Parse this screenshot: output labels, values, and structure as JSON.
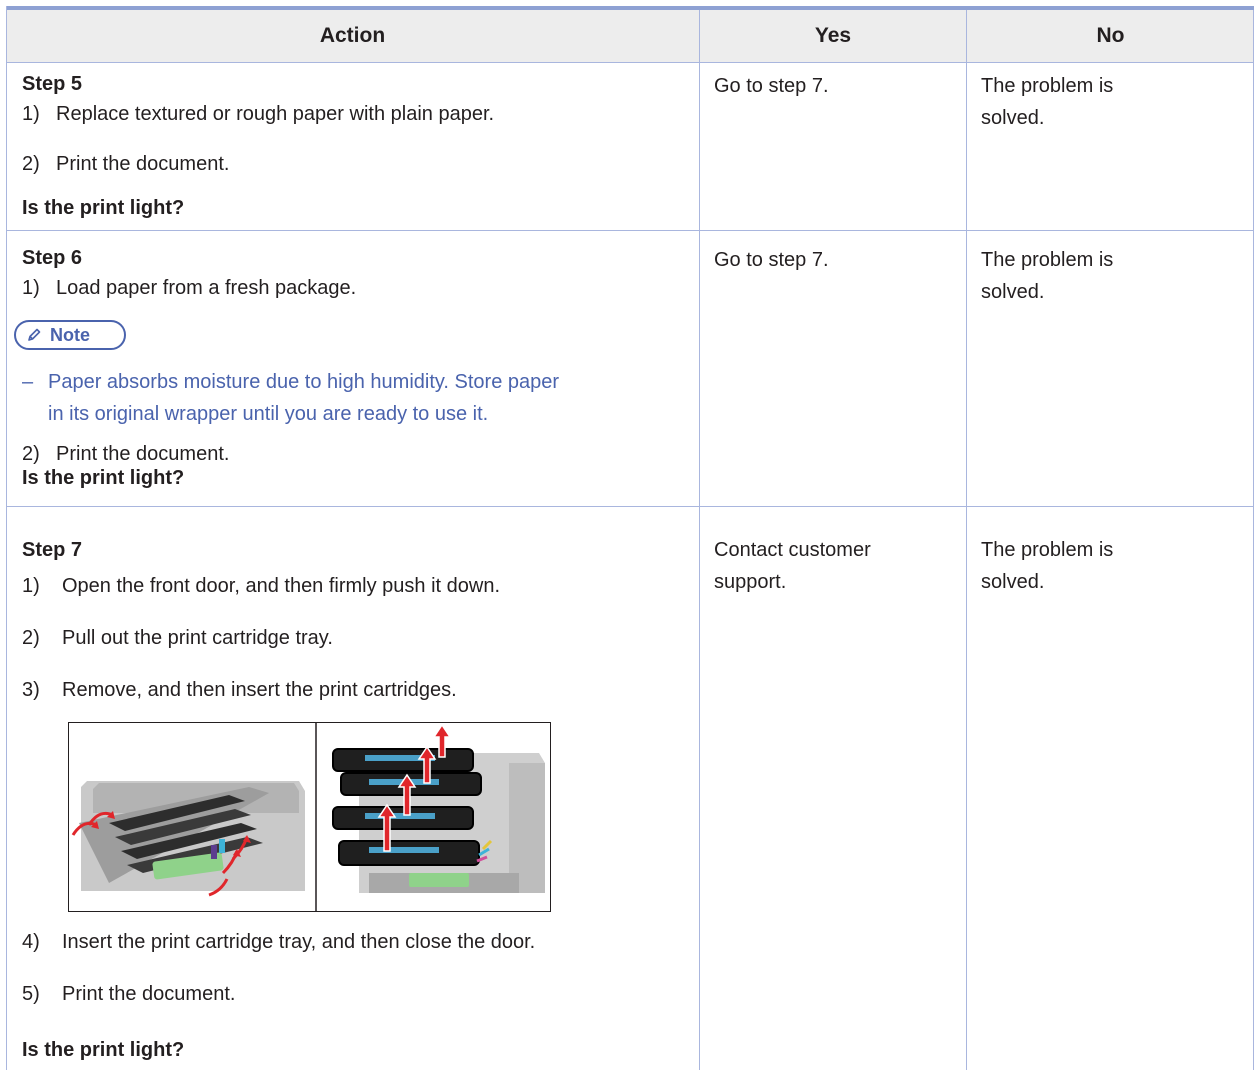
{
  "headers": {
    "action": "Action",
    "yes": "Yes",
    "no": "No"
  },
  "rows": [
    {
      "step": "Step 5",
      "items": [
        {
          "n": "1)",
          "text": "Replace textured or rough paper with plain paper."
        },
        {
          "n": "2)",
          "text": "Print the document."
        }
      ],
      "question": "Is the print light?",
      "yes": "Go to step 7.",
      "no": [
        "The problem is",
        "solved."
      ]
    },
    {
      "step": "Step 6",
      "items": [
        {
          "n": "1)",
          "text": "Load paper from a fresh package."
        },
        {
          "n": "2)",
          "text": "Print the document."
        }
      ],
      "note": {
        "label": "Note",
        "bullet": "–",
        "lines": [
          "Paper absorbs moisture due to high humidity. Store paper",
          "in its original wrapper until you are ready to use it."
        ]
      },
      "question": "Is the print light?",
      "yes": "Go to step 7.",
      "no": [
        "The problem is",
        "solved."
      ]
    },
    {
      "step": "Step 7",
      "items": [
        {
          "n": "1)",
          "text": "Open the front door, and then firmly push it down."
        },
        {
          "n": "2)",
          "text": "Pull out the print cartridge tray."
        },
        {
          "n": "3)",
          "text": "Remove, and then insert the print cartridges."
        },
        {
          "n": "4)",
          "text": "Insert the print cartridge tray, and then close the door."
        },
        {
          "n": "5)",
          "text": "Print the document."
        }
      ],
      "question": "Is the print light?",
      "yes": [
        "Contact customer",
        "support."
      ],
      "no": [
        "The problem is",
        "solved."
      ]
    }
  ],
  "colors": {
    "border": "#a9b6de",
    "header_bg": "#ededed",
    "note": "#4a63ad",
    "arrow": "#e0262b"
  },
  "icons": {
    "note": "pencil-icon"
  }
}
